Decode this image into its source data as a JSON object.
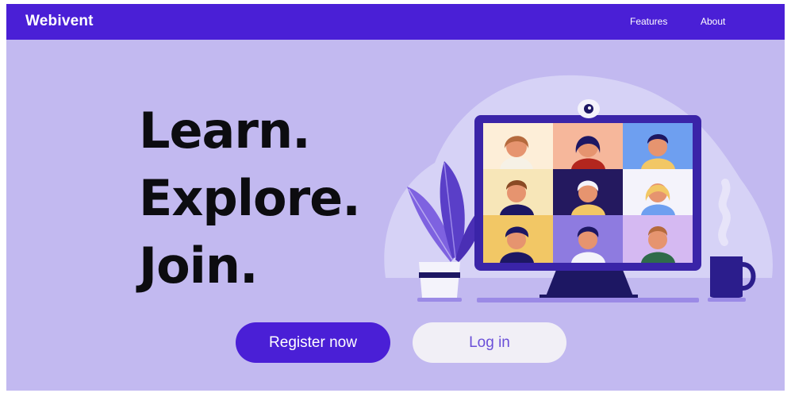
{
  "navbar": {
    "brand": "Webivent",
    "links": [
      "Features",
      "About"
    ]
  },
  "hero": {
    "lines": [
      "Learn.",
      "Explore.",
      "Join."
    ]
  },
  "actions": {
    "register_label": "Register now",
    "login_label": "Log in"
  },
  "colors": {
    "primary": "#4a1fd6",
    "background": "#c2b9f0",
    "login_button_bg": "#f1eff6",
    "hero_text": "#0c0c10"
  },
  "illustration": {
    "subject": "video-conference-monitor",
    "icons": [
      "webcam-icon",
      "plant-icon",
      "mug-icon",
      "participant-avatar-icon"
    ]
  }
}
